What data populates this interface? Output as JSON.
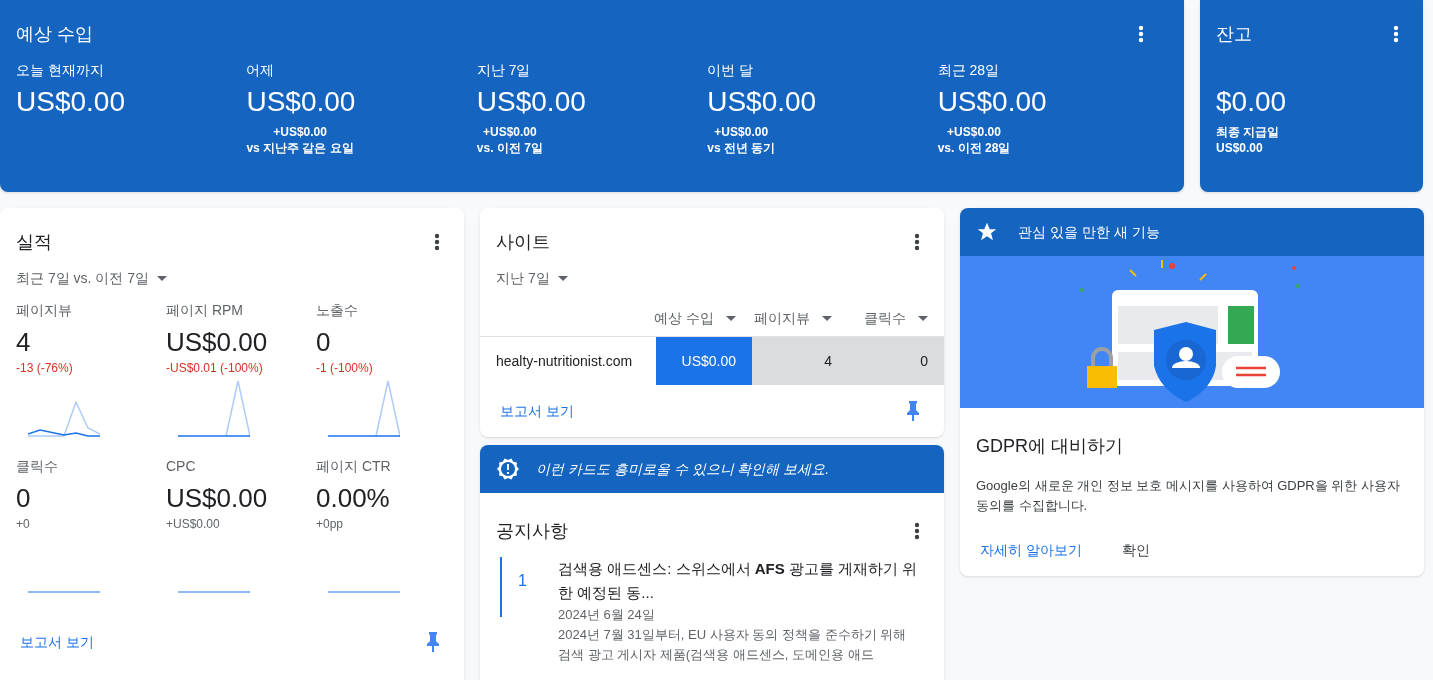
{
  "earnings": {
    "title": "예상 수입",
    "periods": [
      {
        "label": "오늘 현재까지",
        "value": "US$0.00"
      },
      {
        "label": "어제",
        "value": "US$0.00",
        "delta": "+US$0.00",
        "compare": "vs 지난주 같은 요일"
      },
      {
        "label": "지난 7일",
        "value": "US$0.00",
        "delta": "+US$0.00",
        "compare": "vs. 이전 7일"
      },
      {
        "label": "이번 달",
        "value": "US$0.00",
        "delta": "+US$0.00",
        "compare": "vs 전년 동기"
      },
      {
        "label": "최근 28일",
        "value": "US$0.00",
        "delta": "+US$0.00",
        "compare": "vs. 이전 28일"
      }
    ]
  },
  "balance": {
    "title": "잔고",
    "value": "$0.00",
    "last_payment_label": "최종 지급일",
    "last_payment": "US$0.00"
  },
  "performance": {
    "title": "실적",
    "range": "최근 7일 vs. 이전 7일",
    "metrics": [
      {
        "label": "페이지뷰",
        "value": "4",
        "change": "-13 (-76%)",
        "negative": true,
        "kind": "wave"
      },
      {
        "label": "페이지 RPM",
        "value": "US$0.00",
        "change": "-US$0.01 (-100%)",
        "negative": true,
        "kind": "spike"
      },
      {
        "label": "노출수",
        "value": "0",
        "change": "-1 (-100%)",
        "negative": true,
        "kind": "spike"
      },
      {
        "label": "클릭수",
        "value": "0",
        "change": "+0",
        "negative": false,
        "kind": "flat"
      },
      {
        "label": "CPC",
        "value": "US$0.00",
        "change": "+US$0.00",
        "negative": false,
        "kind": "flat"
      },
      {
        "label": "페이지 CTR",
        "value": "0.00%",
        "change": "+0pp",
        "negative": false,
        "kind": "flat"
      }
    ],
    "link": "보고서 보기"
  },
  "sites": {
    "title": "사이트",
    "range": "지난 7일",
    "columns": [
      "예상 수입",
      "페이지뷰",
      "클릭수"
    ],
    "rows": [
      {
        "site": "healty-nutritionist.com",
        "cells": [
          "US$0.00",
          "4",
          "0"
        ]
      }
    ],
    "link": "보고서 보기"
  },
  "suggestion_banner": "이런 카드도 흥미로울 수 있으니 확인해 보세요.",
  "announcements": {
    "title": "공지사항",
    "items": [
      {
        "number": "1",
        "title": "검색용 애드센스: 스위스에서 **AFS** 광고를 게재하기 위한 예정된 동...",
        "date": "2024년 6월 24일",
        "body": "2024년 7월 31일부터, EU 사용자 동의 정책을 준수하기 위해 검색 광고 게시자 제품(검색용 애드센스, 도메인용 애드"
      }
    ]
  },
  "feature": {
    "header": "관심 있을 만한 새 기능",
    "title": "GDPR에 대비하기",
    "body": "Google의 새로운 개인 정보 보호 메시지를 사용하여 GDPR을 위한 사용자 동의를 수집합니다.",
    "actions": [
      "자세히 알아보기",
      "확인"
    ]
  }
}
